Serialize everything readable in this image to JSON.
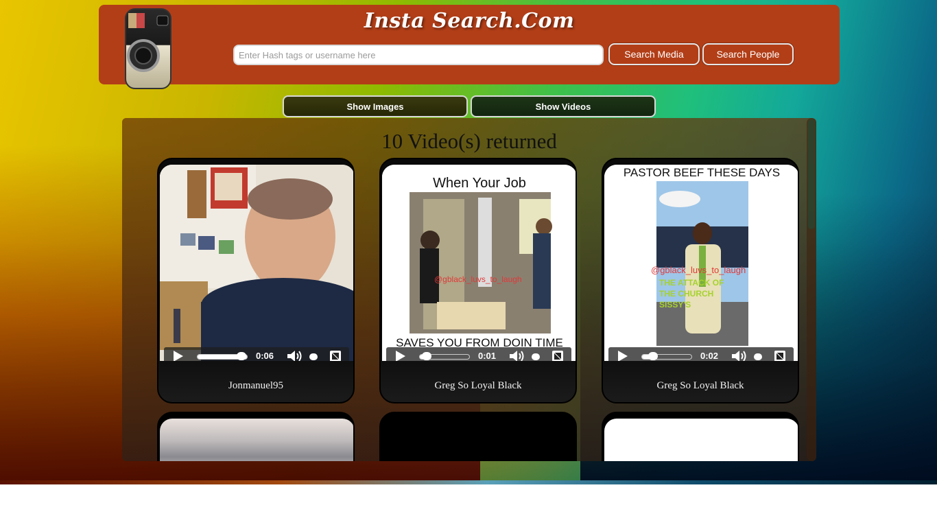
{
  "header": {
    "site_title": "Insta Search.Com",
    "search_placeholder": "Enter Hash tags or username here",
    "search_media_label": "Search Media",
    "search_people_label": "Search People"
  },
  "filters": {
    "show_images_label": "Show Images",
    "show_videos_label": "Show Videos"
  },
  "results": {
    "count_text": "10 Video(s) returned",
    "cards": [
      {
        "username": "Jonmanuel95",
        "time": "0:06",
        "progress": 1.0,
        "caption_top": "",
        "caption_bottom": "",
        "watermark": ""
      },
      {
        "username": "Greg So Loyal Black",
        "time": "0:01",
        "progress": 0.1,
        "caption_top": "When Your Job",
        "caption_bottom": "SAVES YOU FROM DOIN TIME",
        "watermark": "@gblack_luvs_to_laugh"
      },
      {
        "username": "Greg So Loyal Black",
        "time": "0:02",
        "progress": 0.2,
        "caption_top": "PASTOR BEEF THESE DAYS",
        "caption_bottom": "THE ATTACK OF THE CHURCH SISSY'S",
        "watermark": "@gblack_luvs_to_laugh"
      }
    ]
  },
  "colors": {
    "header_bg": "#b23e17",
    "accent_text": "#ffffff"
  },
  "icons": [
    "instagram-logo-icon",
    "play-icon",
    "volume-icon",
    "fullscreen-icon"
  ]
}
